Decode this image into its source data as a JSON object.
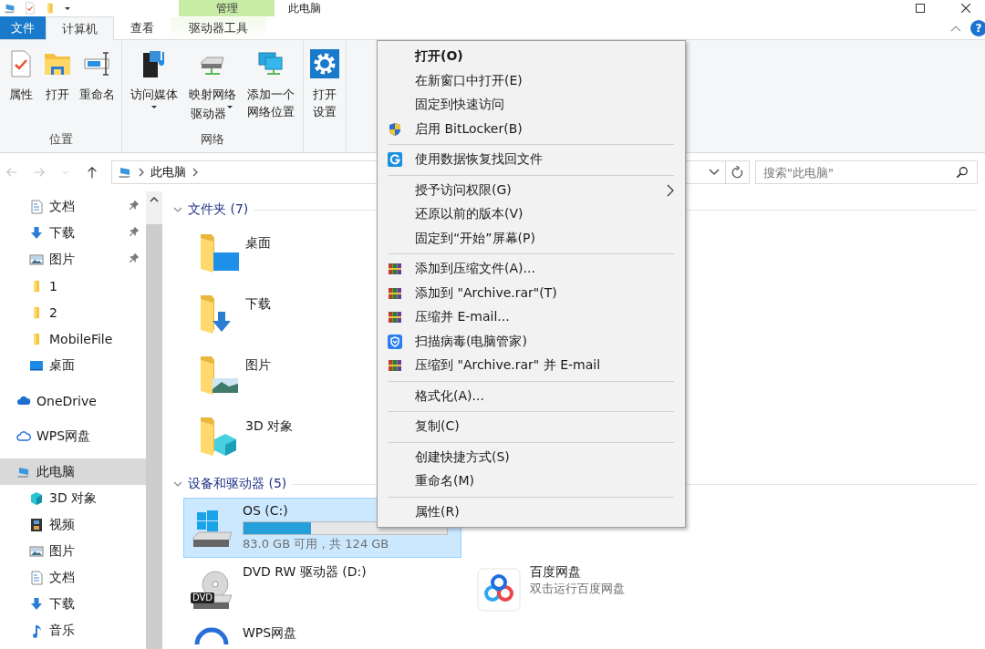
{
  "title_bar": {
    "context_tab": "管理",
    "title": "此电脑"
  },
  "ribbon_tabs": [
    {
      "label": "文件",
      "kind": "file",
      "selected": false
    },
    {
      "label": "计算机",
      "kind": "tab",
      "selected": true
    },
    {
      "label": "查看",
      "kind": "tab",
      "selected": false
    },
    {
      "label": "驱动器工具",
      "kind": "context",
      "selected": false
    }
  ],
  "help_button": "?",
  "ribbon_groups": [
    {
      "label": "位置",
      "buttons": [
        {
          "label": "属性",
          "dropdown": false
        },
        {
          "label": "打开",
          "dropdown": false
        },
        {
          "label": "重命名",
          "dropdown": false
        }
      ]
    },
    {
      "label": "网络",
      "buttons": [
        {
          "label": "访问媒体",
          "dropdown": true
        },
        {
          "label": "映射网络驱动器",
          "dropdown": true
        },
        {
          "label": "添加一个网络位置",
          "dropdown": false
        }
      ]
    },
    {
      "buttons": [
        {
          "label": "打开设置",
          "dropdown": false
        }
      ]
    }
  ],
  "nav_buttons": [
    {
      "kind": "back",
      "disabled": true
    },
    {
      "kind": "forward",
      "disabled": true
    },
    {
      "kind": "recent",
      "disabled": true
    },
    {
      "kind": "up",
      "disabled": false
    }
  ],
  "address_bar": {
    "location": "此电脑"
  },
  "search": {
    "placeholder": "搜索\"此电脑\""
  },
  "nav": {
    "quick_access": [
      {
        "label": "文档",
        "pinned": true,
        "selected": false
      },
      {
        "label": "下载",
        "pinned": true,
        "selected": false
      },
      {
        "label": "图片",
        "pinned": true,
        "selected": false
      },
      {
        "label": "1",
        "pinned": false,
        "selected": false
      },
      {
        "label": "2",
        "pinned": false,
        "selected": false
      },
      {
        "label": "MobileFile",
        "pinned": false,
        "selected": false
      },
      {
        "label": "桌面",
        "pinned": false,
        "selected": false
      }
    ],
    "roots": [
      {
        "label": "OneDrive",
        "selected": false
      },
      {
        "label": "WPS网盘",
        "selected": false
      },
      {
        "label": "此电脑",
        "selected": true,
        "children": [
          {
            "label": "3D 对象",
            "selected": false
          },
          {
            "label": "视频",
            "selected": false
          },
          {
            "label": "图片",
            "selected": false
          },
          {
            "label": "文档",
            "selected": false
          },
          {
            "label": "下载",
            "selected": false
          },
          {
            "label": "音乐",
            "selected": false
          }
        ]
      }
    ]
  },
  "content": {
    "groups": [
      {
        "header": "文件夹 (7)",
        "kind": "folders",
        "expanded": true,
        "items": [
          {
            "name": "桌面"
          },
          {
            "name": "下载"
          },
          {
            "name": "图片"
          },
          {
            "name": "3D 对象"
          }
        ]
      },
      {
        "header": "设备和驱动器 (5)",
        "kind": "drives",
        "expanded": true,
        "items": [
          {
            "name": "OS (C:)",
            "level": 0.33,
            "info": "83.0 GB 可用，共 124 GB",
            "selected": true
          },
          {
            "name": "DVD RW 驱动器 (D:)",
            "badge": "DVD",
            "selected": false
          },
          {
            "name": "百度网盘",
            "info": "双击运行百度网盘",
            "selected": false
          },
          {
            "name": "WPS网盘",
            "selected": false
          }
        ]
      }
    ]
  },
  "context_menu": [
    {
      "kind": "item",
      "label": "打开(O)",
      "bold": true,
      "submenu": false
    },
    {
      "kind": "item",
      "label": "在新窗口中打开(E)",
      "bold": false,
      "submenu": false
    },
    {
      "kind": "item",
      "label": "固定到快速访问",
      "bold": false,
      "submenu": false
    },
    {
      "kind": "item",
      "label": "启用 BitLocker(B)",
      "bold": false,
      "submenu": false
    },
    {
      "kind": "separator"
    },
    {
      "kind": "item",
      "label": "使用数据恢复找回文件",
      "bold": false,
      "submenu": false
    },
    {
      "kind": "separator"
    },
    {
      "kind": "item",
      "label": "授予访问权限(G)",
      "bold": false,
      "submenu": true
    },
    {
      "kind": "item",
      "label": "还原以前的版本(V)",
      "bold": false,
      "submenu": false
    },
    {
      "kind": "item",
      "label": "固定到“开始”屏幕(P)",
      "bold": false,
      "submenu": false
    },
    {
      "kind": "separator"
    },
    {
      "kind": "item",
      "label": "添加到压缩文件(A)...",
      "bold": false,
      "submenu": false
    },
    {
      "kind": "item",
      "label": "添加到 \"Archive.rar\"(T)",
      "bold": false,
      "submenu": false
    },
    {
      "kind": "item",
      "label": "压缩并 E-mail...",
      "bold": false,
      "submenu": false
    },
    {
      "kind": "item",
      "label": "扫描病毒(电脑管家)",
      "bold": false,
      "submenu": false
    },
    {
      "kind": "item",
      "label": "压缩到 \"Archive.rar\" 并 E-mail",
      "bold": false,
      "submenu": false
    },
    {
      "kind": "separator"
    },
    {
      "kind": "item",
      "label": "格式化(A)...",
      "bold": false,
      "submenu": false
    },
    {
      "kind": "separator"
    },
    {
      "kind": "item",
      "label": "复制(C)",
      "bold": false,
      "submenu": false
    },
    {
      "kind": "separator"
    },
    {
      "kind": "item",
      "label": "创建快捷方式(S)",
      "bold": false,
      "submenu": false
    },
    {
      "kind": "item",
      "label": "重命名(M)",
      "bold": false,
      "submenu": false
    },
    {
      "kind": "separator"
    },
    {
      "kind": "item",
      "label": "属性(R)",
      "bold": false,
      "submenu": false
    }
  ]
}
